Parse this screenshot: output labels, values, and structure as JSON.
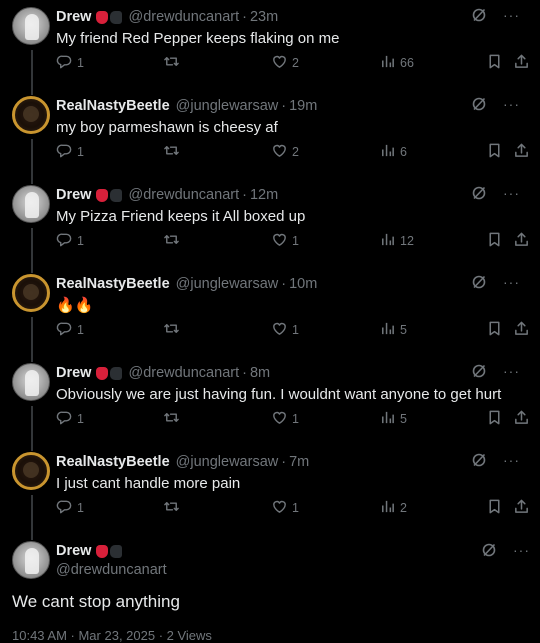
{
  "tweets": [
    {
      "name": "Drew",
      "handle": "@drewduncanart",
      "time": "23m",
      "text": "My friend Red Pepper keeps flaking on me",
      "replies": "1",
      "likes": "2",
      "views": "66",
      "avatar": "drew",
      "badges": true
    },
    {
      "name": "RealNastyBeetle",
      "handle": "@junglewarsaw",
      "time": "19m",
      "text": "my boy parmeshawn is cheesy af",
      "replies": "1",
      "likes": "2",
      "views": "6",
      "avatar": "beetle",
      "badges": false
    },
    {
      "name": "Drew",
      "handle": "@drewduncanart",
      "time": "12m",
      "text": "My Pizza Friend keeps it All boxed up",
      "replies": "1",
      "likes": "1",
      "views": "12",
      "avatar": "drew",
      "badges": true
    },
    {
      "name": "RealNastyBeetle",
      "handle": "@junglewarsaw",
      "time": "10m",
      "text": "🔥🔥",
      "replies": "1",
      "likes": "1",
      "views": "5",
      "avatar": "beetle",
      "badges": false
    },
    {
      "name": "Drew",
      "handle": "@drewduncanart",
      "time": "8m",
      "text": "Obviously we are just having fun. I wouldnt want anyone to get hurt",
      "replies": "1",
      "likes": "1",
      "views": "5",
      "avatar": "drew",
      "badges": true
    },
    {
      "name": "RealNastyBeetle",
      "handle": "@junglewarsaw",
      "time": "7m",
      "text": "I just cant handle more pain",
      "replies": "1",
      "likes": "1",
      "views": "2",
      "avatar": "beetle",
      "badges": false
    }
  ],
  "main_tweet": {
    "name": "Drew",
    "handle": "@drewduncanart",
    "text": "We cant stop anything",
    "meta": "10:43 AM · Mar 23, 2025 · 2 Views"
  },
  "separator": "·",
  "more_glyph": "···",
  "icons": {
    "reply": "reply-icon",
    "retweet": "retweet-icon",
    "like": "heart-icon",
    "views": "views-icon",
    "bookmark": "bookmark-icon",
    "share": "share-icon",
    "grok": "grok-icon",
    "more": "more-icon"
  },
  "colors": {
    "background": "#000000",
    "text": "#e7e9ea",
    "muted": "#71767b",
    "thread_line": "#333639"
  }
}
